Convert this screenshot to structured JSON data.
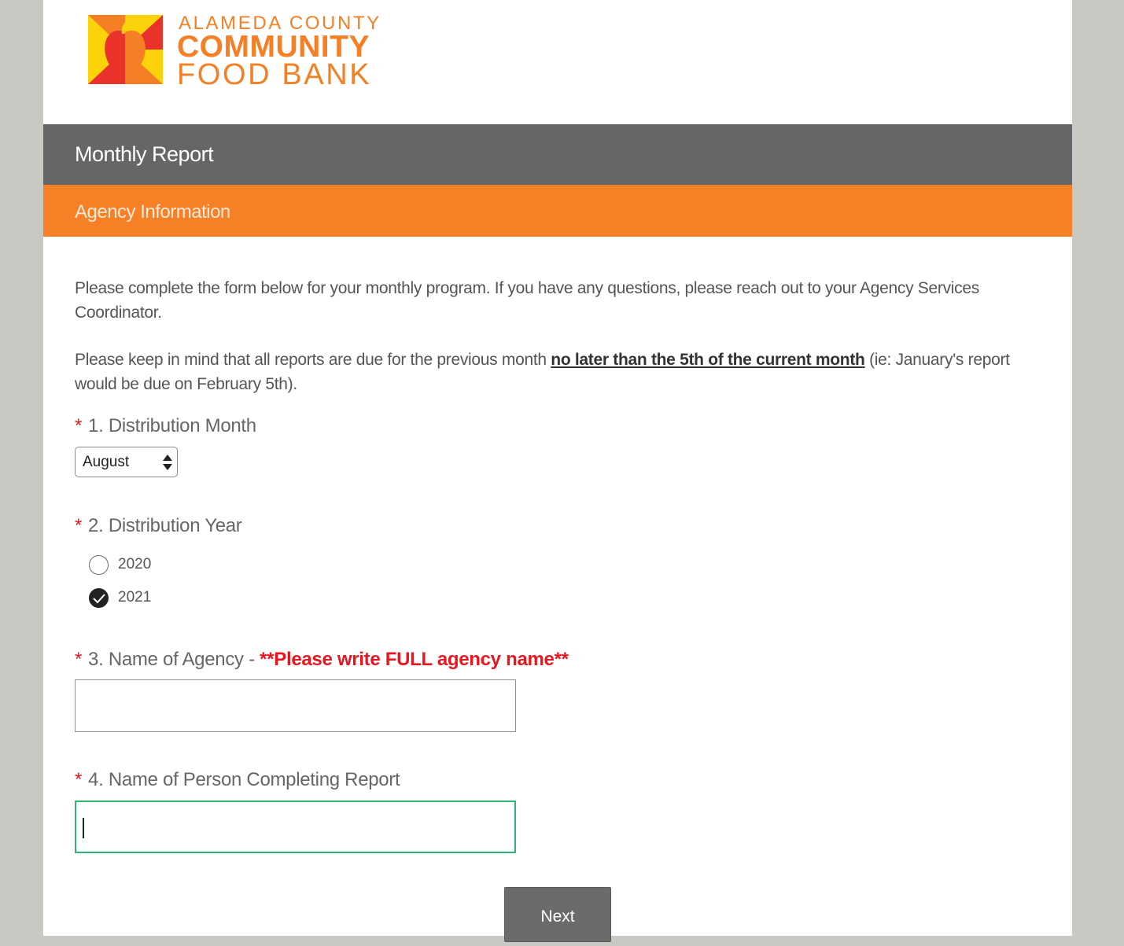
{
  "brand": {
    "line1": "ALAMEDA COUNTY",
    "line2": "COMMUNITY",
    "line3": "FOOD BANK",
    "logo_icon": "apple-logo-icon",
    "colors": {
      "orange": "#f47f25",
      "yellow": "#fcd20a",
      "red": "#e8322a"
    }
  },
  "survey": {
    "title": "Monthly Report"
  },
  "page": {
    "title": "Agency Information"
  },
  "intro": {
    "paragraph1": "Please complete the form below for your monthly program. If you have any questions, please reach out to your Agency Services Coordinator.",
    "paragraph2_before": "Please keep in mind that all reports are due for the previous month ",
    "paragraph2_emphasis": "no later than the 5th of the current month",
    "paragraph2_after": " (ie: January's report would be due on February 5th)."
  },
  "questions": {
    "q1": {
      "required_mark": "*",
      "label": "1. Distribution Month",
      "selected": "August"
    },
    "q2": {
      "required_mark": "*",
      "label": "2. Distribution Year",
      "options": [
        {
          "label": "2020",
          "checked": false
        },
        {
          "label": "2021",
          "checked": true
        }
      ]
    },
    "q3": {
      "required_mark": "*",
      "label": "3. Name of Agency - ",
      "emphasis": "**Please write FULL agency name**",
      "value": ""
    },
    "q4": {
      "required_mark": "*",
      "label": "4. Name of Person Completing Report",
      "value": ""
    }
  },
  "buttons": {
    "next": "Next"
  },
  "colors": {
    "required": "#e8161e",
    "focus": "#2bb673",
    "header_gray": "#666666",
    "accent_orange": "#f58025"
  }
}
